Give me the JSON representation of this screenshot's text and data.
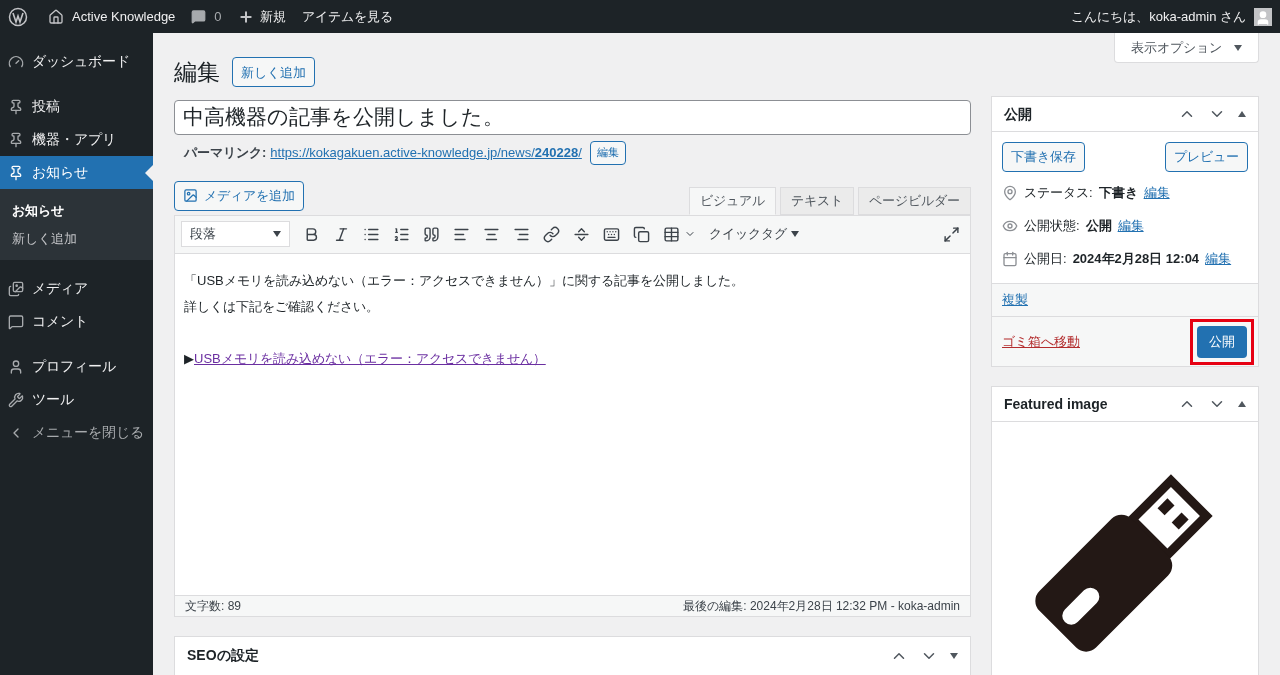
{
  "admin_bar": {
    "site": "Active Knowledge",
    "comments": "0",
    "new": "新規",
    "view": "アイテムを見る",
    "greeting": "こんにちは、koka-admin さん"
  },
  "sidebar": {
    "items": [
      {
        "label": "ダッシュボード",
        "selected": false
      },
      {
        "label": "投稿",
        "selected": false
      },
      {
        "label": "機器・アプリ",
        "selected": false
      },
      {
        "label": "お知らせ",
        "selected": true,
        "children": [
          {
            "label": "お知らせ",
            "selected": true
          },
          {
            "label": "新しく追加",
            "selected": false
          }
        ]
      },
      {
        "label": "メディア",
        "selected": false
      },
      {
        "label": "コメント",
        "selected": false
      },
      {
        "label": "プロフィール",
        "selected": false
      },
      {
        "label": "ツール",
        "selected": false
      },
      {
        "label": "メニューを閉じる",
        "selected": false
      }
    ]
  },
  "screen_options": "表示オプション",
  "heading": "編集",
  "add_new": "新しく追加",
  "post_title": "中高機器の記事を公開しました。",
  "permalink": {
    "label": "パーマリンク:",
    "url": "https://kokagakuen.active-knowledge.jp/news/",
    "slug": "240228",
    "after": "/",
    "edit": "編集"
  },
  "add_media": "メディアを追加",
  "editor_tabs": [
    {
      "label": "ビジュアル",
      "selected": true
    },
    {
      "label": "テキスト",
      "selected": false
    },
    {
      "label": "ページビルダー",
      "selected": false
    }
  ],
  "format_select": "段落",
  "quick_tag": "クイックタグ",
  "content": [
    {
      "kind": "text",
      "text": "「USBメモリを読み込めない（エラー：アクセスできません）」に関する記事を公開しました。"
    },
    {
      "kind": "text",
      "text": "詳しくは下記をご確認ください。"
    },
    {
      "kind": "blank"
    },
    {
      "kind": "link",
      "prefix": "▶",
      "text": "USBメモリを読み込めない（エラー：アクセスできません）"
    }
  ],
  "word_count": "文字数: 89",
  "last_edit": "最後の編集: 2024年2月28日 12:32 PM - koka-admin",
  "seo_box": {
    "title": "SEOの設定",
    "expanded": false
  },
  "publish_box": {
    "title": "公開",
    "expanded": true,
    "save_draft": "下書き保存",
    "preview": "プレビュー",
    "rows": [
      {
        "label": "ステータス:",
        "value": "下書き",
        "link": "編集"
      },
      {
        "label": "公開状態:",
        "value": "公開",
        "link": "編集"
      },
      {
        "label": "公開日:",
        "value": "2024年2月28日 12:04",
        "link": "編集"
      }
    ],
    "duplicate": "複製",
    "trash": "ゴミ箱へ移動",
    "publish": "公開",
    "publish_highlighted": true
  },
  "featured_box": {
    "title": "Featured image",
    "expanded": true
  }
}
